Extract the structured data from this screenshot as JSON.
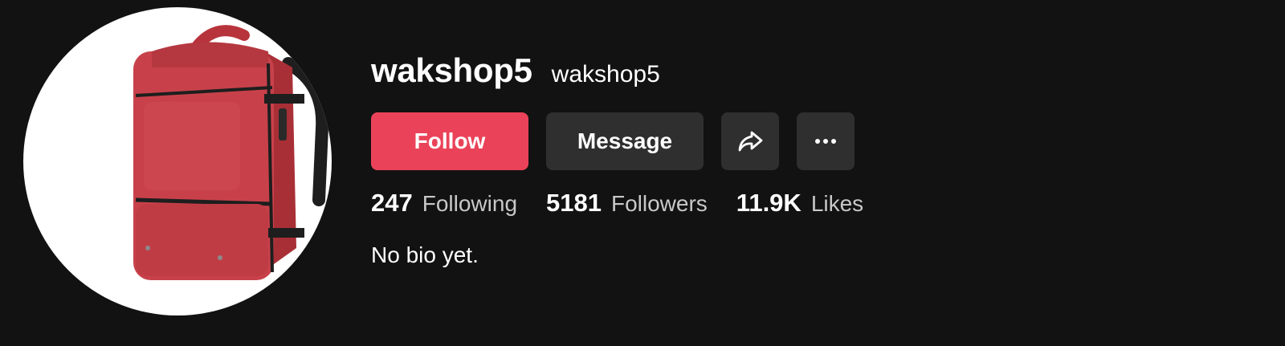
{
  "profile": {
    "username": "wakshop5",
    "nickname": "wakshop5",
    "avatar_icon": "red-backpack-avatar",
    "bio": "No bio yet."
  },
  "actions": {
    "follow_label": "Follow",
    "message_label": "Message",
    "share_icon": "share-arrow-icon",
    "more_icon": "more-dots-icon"
  },
  "stats": [
    {
      "value": "247",
      "label": "Following"
    },
    {
      "value": "5181",
      "label": "Followers"
    },
    {
      "value": "11.9K",
      "label": "Likes"
    }
  ],
  "colors": {
    "background": "#121212",
    "follow_button": "#ea4359",
    "secondary_button": "#2f2f2f",
    "stat_label": "#c8c8c8"
  }
}
